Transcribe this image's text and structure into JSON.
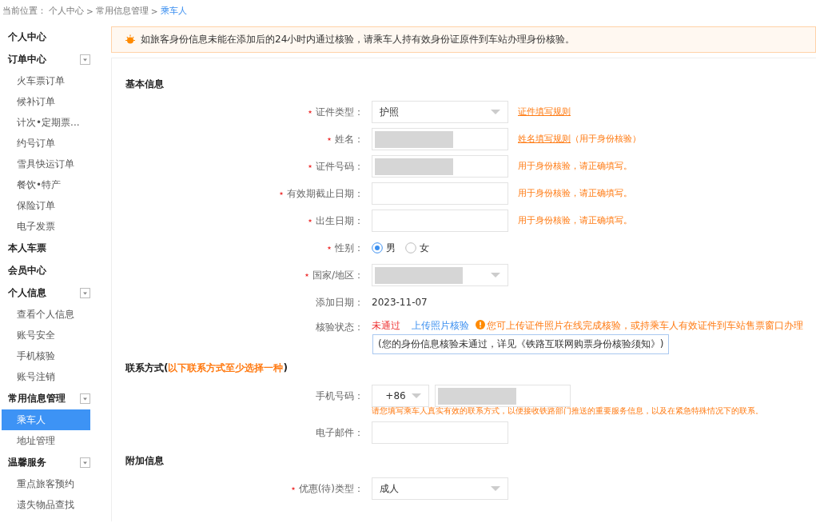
{
  "breadcrumb": {
    "prefix": "当前位置：",
    "separator": ">",
    "items": [
      {
        "label": "个人中心",
        "current": false
      },
      {
        "label": "常用信息管理",
        "current": false
      },
      {
        "label": "乘车人",
        "current": true
      }
    ]
  },
  "sidebar": {
    "groups": [
      {
        "title": "个人中心",
        "expanded": false
      },
      {
        "title": "订单中心",
        "expanded": true,
        "children": [
          {
            "label": "火车票订单",
            "selected": false
          },
          {
            "label": "候补订单",
            "selected": false
          },
          {
            "label": "计次•定期票...",
            "selected": false
          },
          {
            "label": "约号订单",
            "selected": false
          },
          {
            "label": "雪具快运订单",
            "selected": false
          },
          {
            "label": "餐饮•特产",
            "selected": false
          },
          {
            "label": "保险订单",
            "selected": false
          },
          {
            "label": "电子发票",
            "selected": false
          }
        ]
      },
      {
        "title": "本人车票",
        "expanded": false
      },
      {
        "title": "会员中心",
        "expanded": false
      },
      {
        "title": "个人信息",
        "expanded": true,
        "children": [
          {
            "label": "查看个人信息",
            "selected": false
          },
          {
            "label": "账号安全",
            "selected": false
          },
          {
            "label": "手机核验",
            "selected": false
          },
          {
            "label": "账号注销",
            "selected": false
          }
        ]
      },
      {
        "title": "常用信息管理",
        "expanded": true,
        "children": [
          {
            "label": "乘车人",
            "selected": true
          },
          {
            "label": "地址管理",
            "selected": false
          }
        ]
      },
      {
        "title": "温馨服务",
        "expanded": true,
        "children": [
          {
            "label": "重点旅客预约",
            "selected": false
          },
          {
            "label": "遗失物品查找",
            "selected": false
          }
        ]
      }
    ]
  },
  "notice": "如旅客身份信息未能在添加后的24小时内通过核验，请乘车人持有效身份证原件到车站办理身份核验。",
  "sections": [
    {
      "title": "基本信息",
      "rows": [
        {
          "kind": "select",
          "label": "证件类型：",
          "required": true,
          "value": "护照",
          "redacted": false,
          "hint": "证件填写规则",
          "hint_link": true
        },
        {
          "kind": "input",
          "label": "姓名：",
          "required": true,
          "redacted": true,
          "hint": "姓名填写规则",
          "hint_link": true,
          "hint_extra": "（用于身份核验）"
        },
        {
          "kind": "input",
          "label": "证件号码：",
          "required": true,
          "redacted": true,
          "hint": "用于身份核验，请正确填写。",
          "hint_link": false
        },
        {
          "kind": "input",
          "label": "有效期截止日期：",
          "required": true,
          "redacted": false,
          "hint": "用于身份核验，请正确填写。",
          "hint_link": false
        },
        {
          "kind": "input",
          "label": "出生日期：",
          "required": true,
          "redacted": false,
          "hint": "用于身份核验，请正确填写。",
          "hint_link": false
        },
        {
          "kind": "radio",
          "label": "性别：",
          "required": true,
          "options": [
            {
              "label": "男",
              "selected": true
            },
            {
              "label": "女",
              "selected": false
            }
          ]
        },
        {
          "kind": "select",
          "label": "国家/地区：",
          "required": true,
          "redacted": true
        },
        {
          "kind": "text",
          "label": "添加日期：",
          "required": false,
          "value": "2023-11-07"
        },
        {
          "kind": "status",
          "label": "核验状态：",
          "required": false,
          "value": "未通过",
          "link": "上传照片核验",
          "note": "您可上传证件照片在线完成核验，或持乘车人有效证件到车站售票窗口办理",
          "tooltip": "(您的身份信息核验未通过，详见《铁路互联网购票身份核验须知》)"
        }
      ]
    },
    {
      "title": "联系方式(",
      "note": "以下联系方式至少选择一种",
      "suffix": ")",
      "rows": [
        {
          "kind": "phone",
          "label": "手机号码：",
          "required": false,
          "code": "+86",
          "redacted": true,
          "below": "请您填写乘车人真实有效的联系方式，以便接收铁路部门推送的重要服务信息，以及在紧急特殊情况下的联系。"
        },
        {
          "kind": "input",
          "label": "电子邮件：",
          "required": false,
          "redacted": false
        }
      ]
    },
    {
      "title": "附加信息",
      "rows": [
        {
          "kind": "select",
          "label": "优惠(待)类型：",
          "required": true,
          "value": "成人",
          "redacted": false
        }
      ]
    }
  ]
}
